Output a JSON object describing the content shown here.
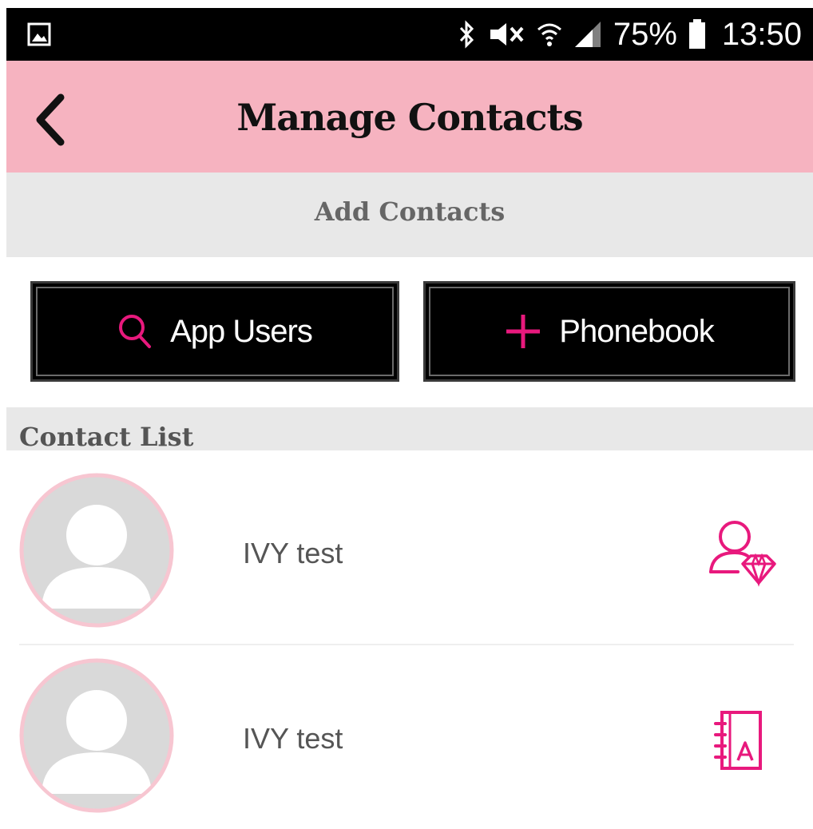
{
  "status_bar": {
    "battery_percent": "75%",
    "time": "13:50",
    "icons": [
      "gallery-icon",
      "bluetooth-icon",
      "mute-icon",
      "wifi-icon",
      "signal-icon",
      "battery-icon"
    ]
  },
  "app_bar": {
    "title": "Manage Contacts",
    "back_icon": "chevron-left-icon"
  },
  "add_contacts": {
    "label": "Add Contacts",
    "buttons": [
      {
        "label": "App Users",
        "icon": "search-icon"
      },
      {
        "label": "Phonebook",
        "icon": "plus-icon"
      }
    ]
  },
  "contact_list": {
    "label": "Contact List",
    "items": [
      {
        "name": "IVY test",
        "action_icon": "diamond-user-icon"
      },
      {
        "name": "IVY test",
        "action_icon": "address-book-icon"
      }
    ]
  },
  "colors": {
    "accent_pink": "#e8197d",
    "app_bar_pink": "#f6b3c0",
    "section_gray": "#e8e8e8",
    "button_black": "#000000"
  }
}
